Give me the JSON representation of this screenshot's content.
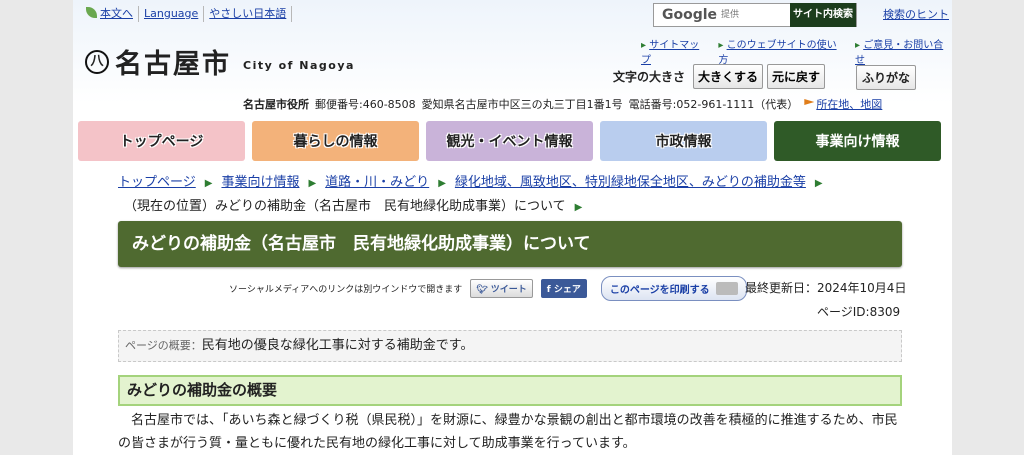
{
  "header": {
    "top_links": [
      "本文へ",
      "Language",
      "やさしい日本語"
    ],
    "search": {
      "google_label": "Google",
      "provided": "提供",
      "button": "サイト内検索",
      "hint": "検索のヒント"
    },
    "logo": {
      "symbol": "八",
      "name": "名古屋市",
      "english": "City of Nagoya"
    },
    "sub_links": [
      "サイトマップ",
      "このウェブサイトの使い方",
      "ご意見・お問い合せ"
    ],
    "font_size": {
      "label": "文字の大きさ",
      "enlarge": "大きくする",
      "reset": "元に戻す"
    },
    "furigana": "ふりがな",
    "address": {
      "office": "名古屋市役所",
      "postal": "郵便番号:460-8508",
      "location": "愛知県名古屋市中区三の丸三丁目1番1号",
      "phone": "電話番号:052-961-1111（代表）",
      "map_link": "所在地、地図"
    }
  },
  "nav": [
    {
      "label": "トップページ",
      "color": "#f4c3c8"
    },
    {
      "label": "暮らしの情報",
      "color": "#f3b27a"
    },
    {
      "label": "観光・イベント情報",
      "color": "#c9b3d9"
    },
    {
      "label": "市政情報",
      "color": "#b9cdee"
    },
    {
      "label": "事業向け情報",
      "color": "#2f5a27"
    }
  ],
  "breadcrumb": {
    "items": [
      "トップページ",
      "事業向け情報",
      "道路・川・みどり",
      "緑化地域、風致地区、特別緑地保全地区、みどりの補助金等"
    ],
    "current": "（現在の位置）みどりの補助金（名古屋市　民有地緑化助成事業）について"
  },
  "page": {
    "title": "みどりの補助金（名古屋市　民有地緑化助成事業）について",
    "social_note": "ソーシャルメディアへのリンクは別ウインドウで開きます",
    "tweet": "ツイート",
    "share": "シェア",
    "print": "このページを印刷する",
    "updated": "最終更新日：2024年10月4日",
    "page_id": "ページID:8309",
    "summary_label": "ページの概要：",
    "summary_text": "民有地の優良な緑化工事に対する補助金です。",
    "section_heading": "みどりの補助金の概要",
    "body_text": "名古屋市では、「あいち森と緑づくり税（県民税）」を財源に、緑豊かな景観の創出と都市環境の改善を積極的に推進するため、市民の皆さまが行う質・量ともに優れた民有地の緑化工事に対して助成事業を行っています。"
  }
}
